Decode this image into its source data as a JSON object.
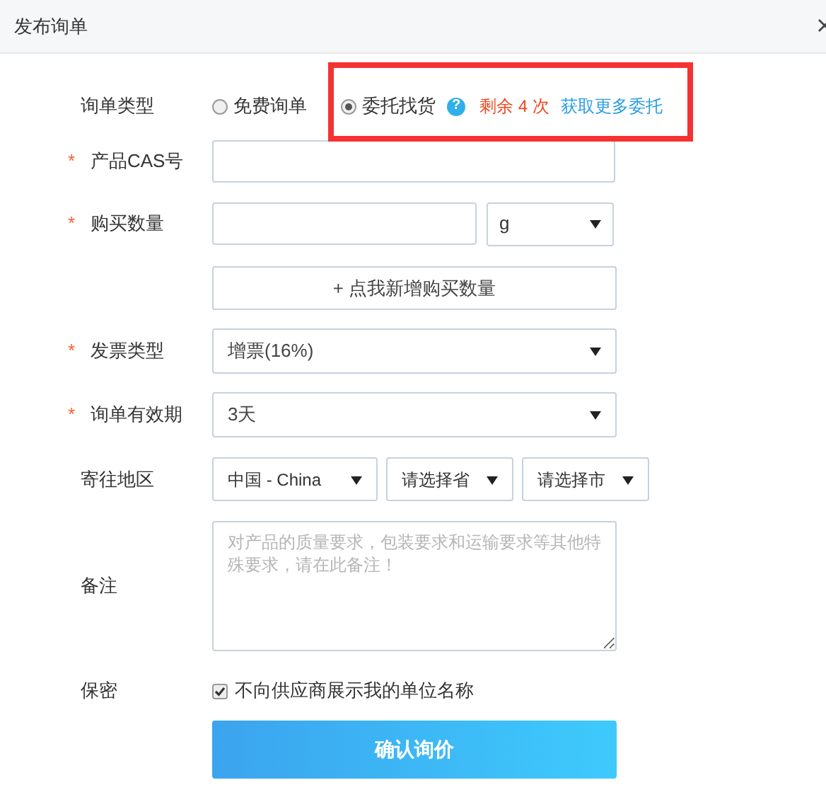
{
  "dialog": {
    "title": "发布询单"
  },
  "inquiry_type": {
    "label": "询单类型",
    "highlighted": true,
    "options": [
      {
        "label": "免费询单",
        "selected": false
      },
      {
        "label": "委托找货",
        "selected": true
      }
    ],
    "help_mark": "?",
    "remaining": "剩余 4 次",
    "more_link": "获取更多委托"
  },
  "cas": {
    "label": "产品CAS号",
    "required_mark": "*"
  },
  "quantity": {
    "label": "购买数量",
    "required_mark": "*",
    "unit": "g"
  },
  "add_quantity_button": "+ 点我新增购买数量",
  "invoice": {
    "label": "发票类型",
    "required_mark": "*",
    "value": "增票(16%)"
  },
  "validity": {
    "label": "询单有效期",
    "required_mark": "*",
    "value": "3天"
  },
  "region": {
    "label": "寄往地区",
    "selects": [
      "中国 - China",
      "请选择省",
      "请选择市"
    ]
  },
  "remarks": {
    "label": "备注",
    "placeholder": "对产品的质量要求，包装要求和运输要求等其他特殊要求，请在此备注！"
  },
  "confidential": {
    "label": "保密",
    "option": {
      "label": "不向供应商展示我的单位名称",
      "checked": true
    }
  },
  "submit_button": "确认询价"
}
